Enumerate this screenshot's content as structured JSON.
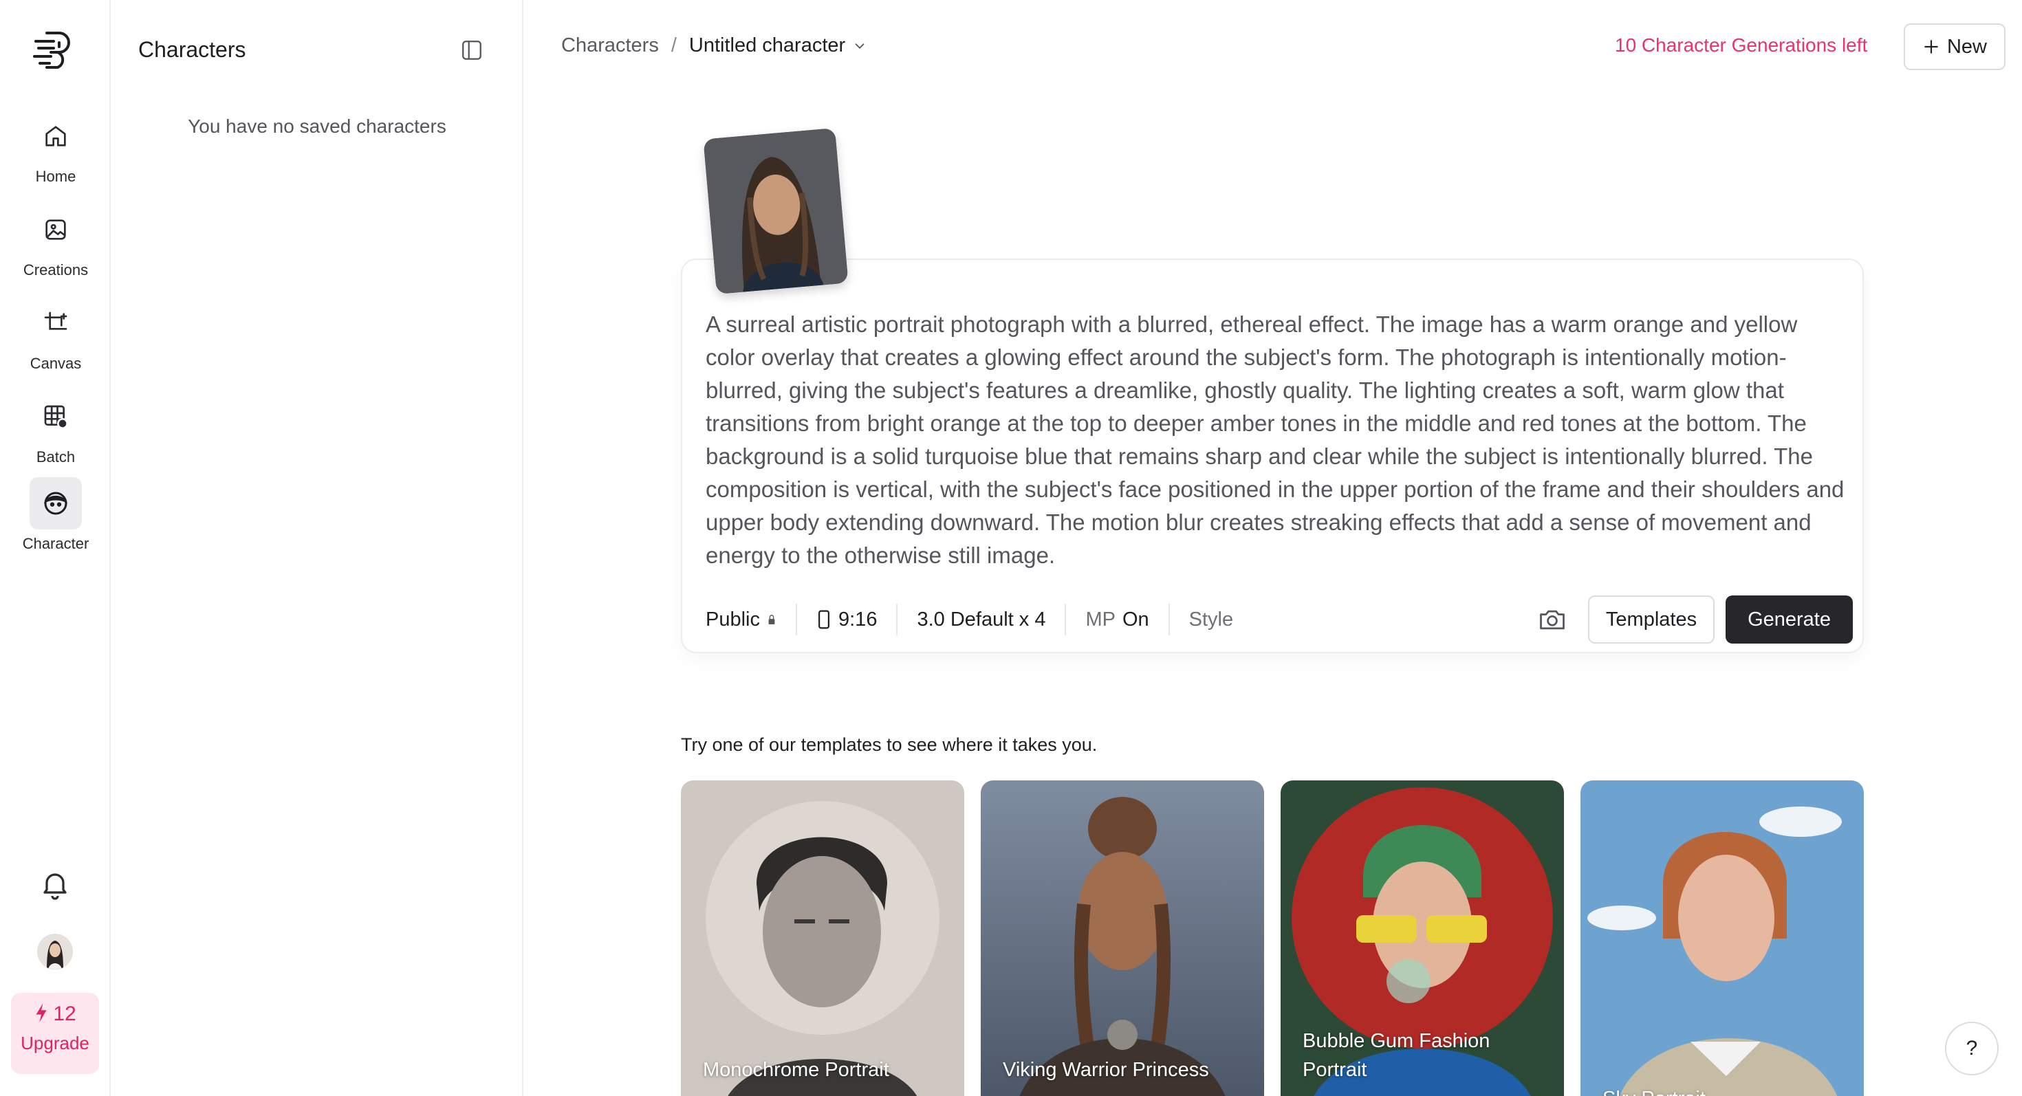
{
  "nav": {
    "items": [
      {
        "label": "Home",
        "icon": "home-icon"
      },
      {
        "label": "Creations",
        "icon": "image-icon"
      },
      {
        "label": "Canvas",
        "icon": "crop-icon"
      },
      {
        "label": "Batch",
        "icon": "batch-grid-icon"
      },
      {
        "label": "Character",
        "icon": "character-face-icon",
        "active": true
      }
    ],
    "credits": "12",
    "upgrade_label": "Upgrade"
  },
  "panel": {
    "title": "Characters",
    "empty_text": "You have no saved characters"
  },
  "header": {
    "breadcrumb_root": "Characters",
    "breadcrumb_separator": "/",
    "breadcrumb_current": "Untitled character",
    "generations_left": "10 Character Generations left",
    "new_button": "New"
  },
  "composer": {
    "prompt": "A surreal artistic portrait photograph with a blurred, ethereal effect. The image has a warm orange and yellow color overlay that creates a glowing effect around the subject's form. The photograph is intentionally motion-blurred, giving the subject's features a dreamlike, ghostly quality. The lighting creates a soft, warm glow that transitions from bright orange at the top to deeper amber tones in the middle and red tones at the bottom. The background is a solid turquoise blue that remains sharp and clear while the subject is intentionally blurred. The composition is vertical, with the subject's face positioned in the upper portion of the frame and their shoulders and upper body extending downward. The motion blur creates streaking effects that add a sense of movement and energy to the otherwise still image.",
    "visibility": "Public",
    "aspect_ratio": "9:16",
    "model": "3.0 Default x 4",
    "mp_label": "MP",
    "mp_value": "On",
    "style_label": "Style",
    "templates_button": "Templates",
    "generate_button": "Generate"
  },
  "templates": {
    "heading": "Try one of our templates to see where it takes you.",
    "items": [
      {
        "label": "Monochrome Portrait"
      },
      {
        "label": "Viking Warrior Princess"
      },
      {
        "label": "Bubble Gum Fashion Portrait"
      },
      {
        "label": "Sky Portrait"
      }
    ]
  },
  "help_label": "?",
  "colors": {
    "accent_pink": "#e8336b",
    "upgrade_bg": "#fde6ee",
    "generate_bg": "#26262b"
  }
}
